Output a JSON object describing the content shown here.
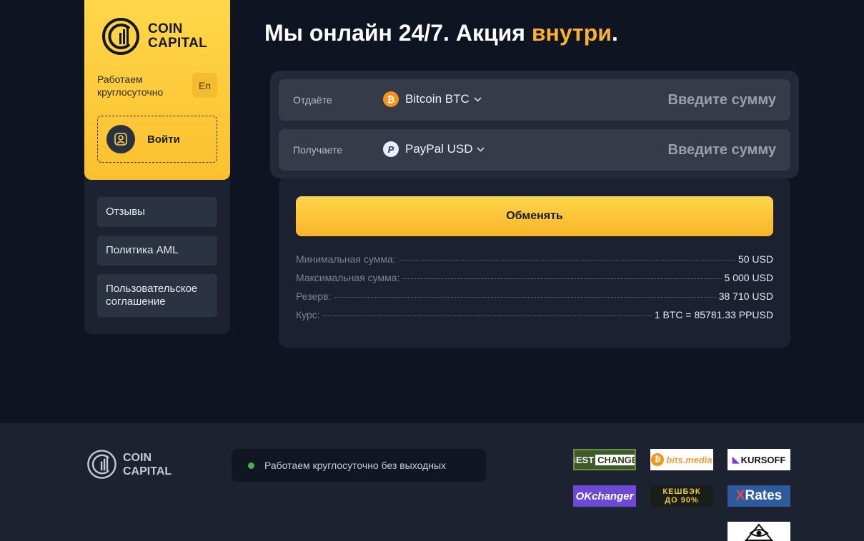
{
  "brand": {
    "name_line1": "COIN",
    "name_line2": "CAPITAL"
  },
  "sidebar": {
    "working_hours": "Работаем круглосуточно",
    "lang_button": "En",
    "login_label": "Войти",
    "menu": [
      {
        "label": "Отзывы"
      },
      {
        "label": "Политика AML"
      },
      {
        "label": "Пользовательское соглашение"
      }
    ]
  },
  "headline": {
    "text": "Мы онлайн 24/7. Акция ",
    "accent": "внутри",
    "end": "."
  },
  "exchange": {
    "give": {
      "label": "Отдаёте",
      "currency": "Bitcoin BTC",
      "icon": "bitcoin-icon",
      "placeholder": "Введите сумму"
    },
    "get": {
      "label": "Получаете",
      "currency": "PayPal USD",
      "icon": "paypal-icon",
      "placeholder": "Введите сумму"
    },
    "button_label": "Обменять",
    "info": [
      {
        "label": "Минимальная сумма:",
        "value": "50 USD"
      },
      {
        "label": "Максимальная сумма:",
        "value": "5 000 USD"
      },
      {
        "label": "Резерв:",
        "value": "38 710 USD"
      },
      {
        "label": "Курс:",
        "value": "1 BTC = 85781.33 PPUSD"
      }
    ]
  },
  "footer": {
    "status_text": "Работаем круглосуточно без выходных",
    "partners": {
      "bestchange_a": "BEST",
      "bestchange_b": "CHANGE",
      "bits": "bits.media",
      "kursoff": "KURSOFF",
      "okchanger": "OKchanger",
      "cashback_1": "КЕШБЭК",
      "cashback_2": "ДО 90%",
      "xrates": "Rates",
      "xrates_x": "X"
    }
  },
  "colors": {
    "accent": "#fcb130",
    "brand_yellow": "#ffd74a",
    "background": "#0e1422",
    "panel": "#1c2230",
    "status_dot": "#4caf50"
  }
}
